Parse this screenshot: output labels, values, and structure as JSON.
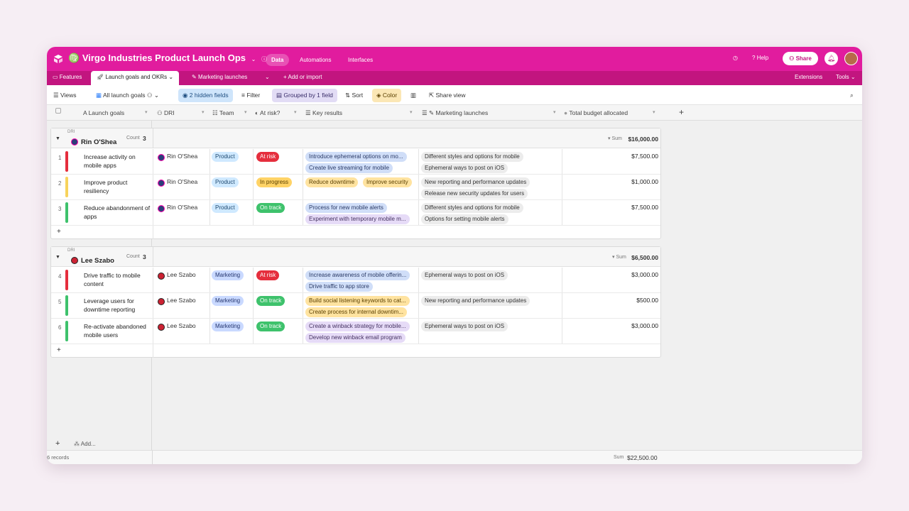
{
  "app": {
    "title": "Virgo Industries Product Launch Ops",
    "nav_tabs": [
      "Data",
      "Automations",
      "Interfaces"
    ],
    "help": "Help",
    "share": "Share",
    "brand_color": "#e11c9e"
  },
  "tables": {
    "items": [
      "Features",
      "Launch goals and OKRs",
      "Marketing launches"
    ],
    "add_import": "Add or import",
    "extensions": "Extensions",
    "tools": "Tools"
  },
  "viewbar": {
    "views": "Views",
    "current_view": "All launch goals",
    "hidden_fields": "2 hidden fields",
    "filter": "Filter",
    "grouped": "Grouped by 1 field",
    "sort": "Sort",
    "color": "Color",
    "share_view": "Share view"
  },
  "columns": [
    "Launch goals",
    "DRI",
    "Team",
    "At risk?",
    "Key results",
    "Marketing launches",
    "Total budget allocated"
  ],
  "groups": [
    {
      "label": "DRI",
      "name": "Rin O'Shea",
      "count_label": "Count",
      "count": "3",
      "sum_label": "Sum",
      "sum": "$16,000.00",
      "rows": [
        {
          "n": "1",
          "goal": "Increase activity on mobile apps",
          "dri": "Rin O'Shea",
          "team": "Product",
          "status": "At risk",
          "kr": [
            "Introduce ephemeral options on mo...",
            "Create live streaming for mobile"
          ],
          "ml": [
            "Different styles and options for mobile",
            "Ephemeral ways to post on iOS"
          ],
          "budget": "$7,500.00"
        },
        {
          "n": "2",
          "goal": "Improve product resiliency",
          "dri": "Rin O'Shea",
          "team": "Product",
          "status": "In progress",
          "kr": [
            "Reduce downtime",
            "Improve security"
          ],
          "ml": [
            "New reporting and performance updates",
            "Release new security updates for users"
          ],
          "budget": "$1,000.00"
        },
        {
          "n": "3",
          "goal": "Reduce abandonment of apps",
          "dri": "Rin O'Shea",
          "team": "Product",
          "status": "On track",
          "kr": [
            "Process for new mobile alerts",
            "Experiment with temporary mobile m..."
          ],
          "ml": [
            "Different styles and options for mobile",
            "Options for setting mobile alerts"
          ],
          "budget": "$7,500.00"
        }
      ]
    },
    {
      "label": "DRI",
      "name": "Lee Szabo",
      "count_label": "Count",
      "count": "3",
      "sum_label": "Sum",
      "sum": "$6,500.00",
      "rows": [
        {
          "n": "4",
          "goal": "Drive traffic to mobile content",
          "dri": "Lee Szabo",
          "team": "Marketing",
          "status": "At risk",
          "kr": [
            "Increase awareness of mobile offerin...",
            "Drive traffic to app store"
          ],
          "ml": [
            "Ephemeral ways to post on iOS"
          ],
          "budget": "$3,000.00"
        },
        {
          "n": "5",
          "goal": "Leverage users for downtime reporting",
          "dri": "Lee Szabo",
          "team": "Marketing",
          "status": "On track",
          "kr": [
            "Build social listening keywords to cat...",
            "Create process for internal downtim..."
          ],
          "ml": [
            "New reporting and performance updates"
          ],
          "budget": "$500.00"
        },
        {
          "n": "6",
          "goal": "Re-activate abandoned mobile users",
          "dri": "Lee Szabo",
          "team": "Marketing",
          "status": "On track",
          "kr": [
            "Create a winback strategy for mobile...",
            "Develop new winback email program"
          ],
          "ml": [
            "Ephemeral ways to post on iOS"
          ],
          "budget": "$3,000.00"
        }
      ]
    }
  ],
  "add_row_symbol": "+",
  "footer": {
    "records": "6 records",
    "add": "Add...",
    "sum_label": "Sum",
    "sum": "$22,500.00"
  },
  "status_colors": {
    "At risk": "#e52e3d",
    "In progress": "#ffd366",
    "On track": "#3ec26c"
  }
}
